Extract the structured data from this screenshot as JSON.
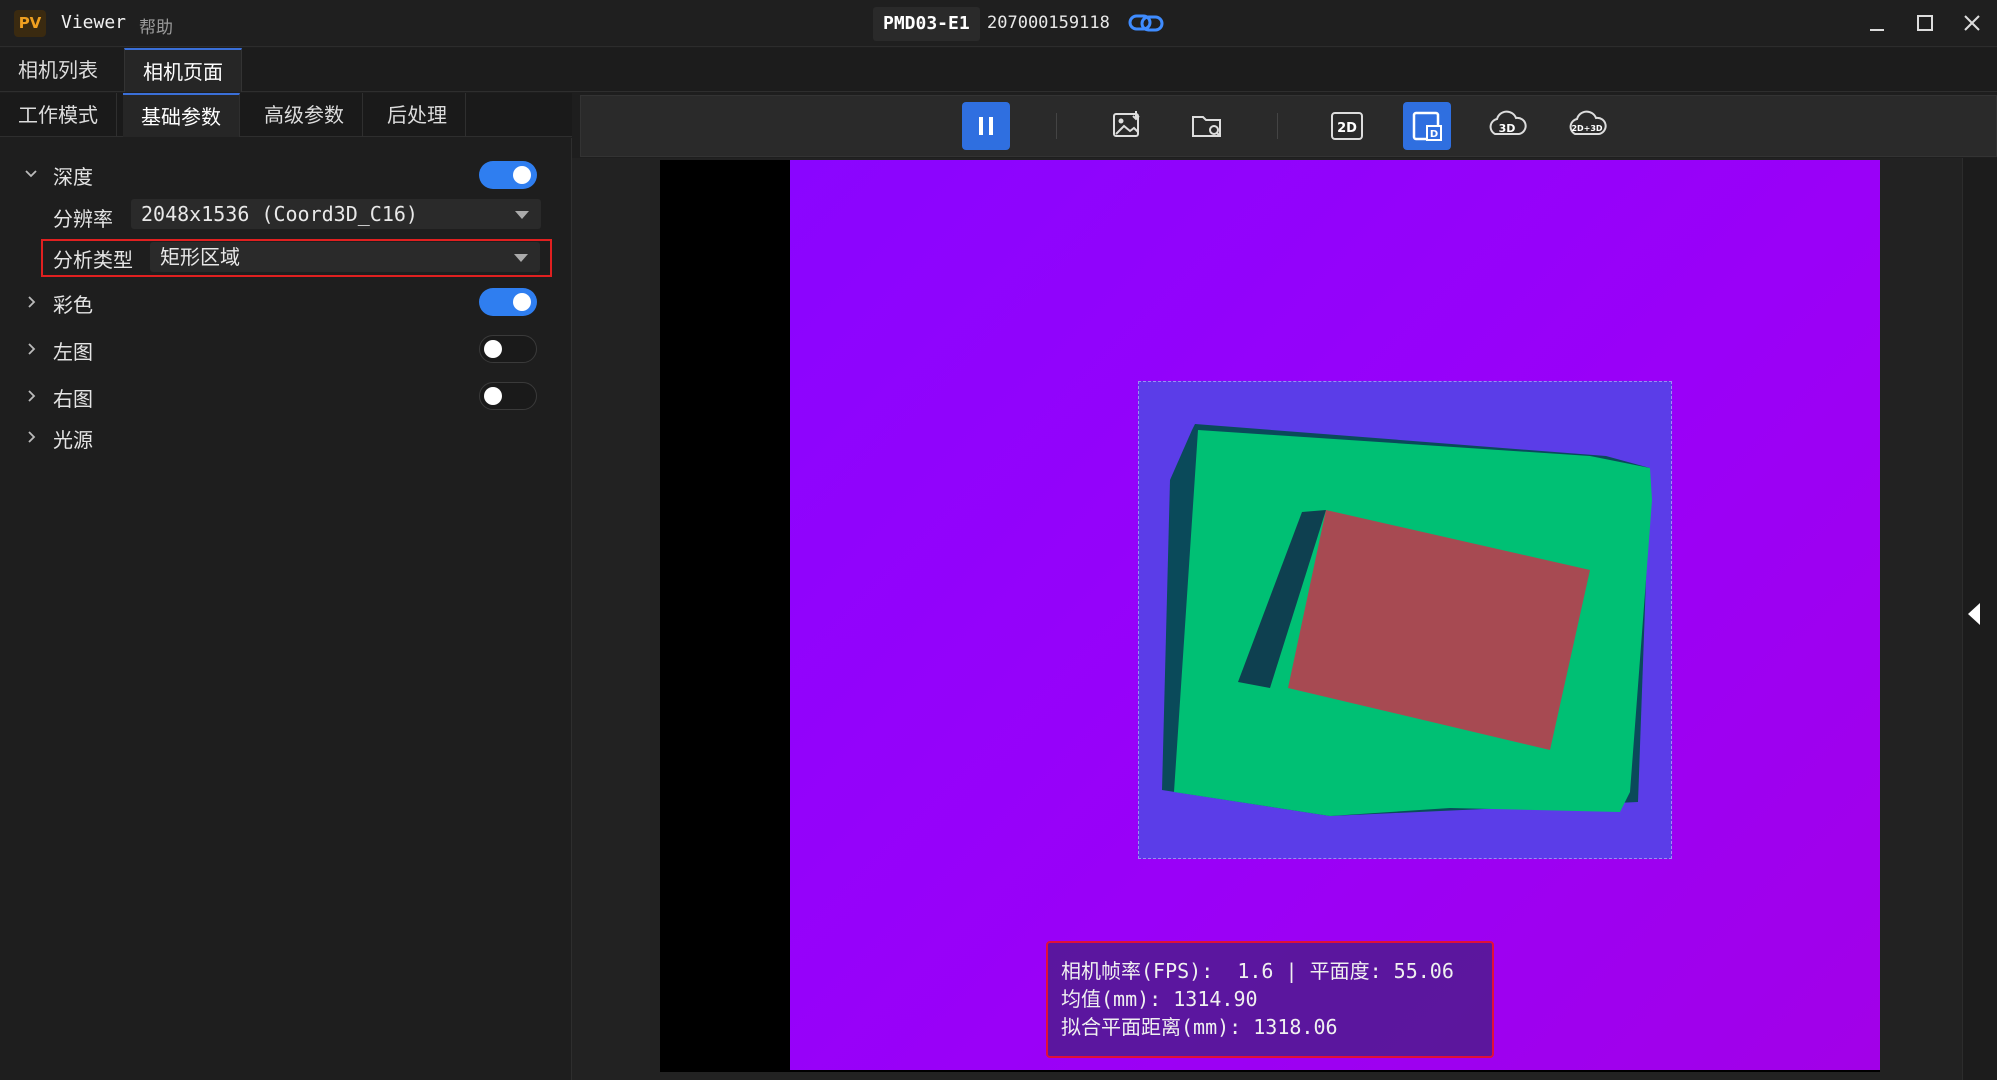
{
  "app": {
    "logo": "PV",
    "name": "Viewer",
    "menu_help": "帮助"
  },
  "camera": {
    "model": "PMD03-E1",
    "serial": "207000159118"
  },
  "tabs_top": [
    {
      "label": "相机列表",
      "active": false
    },
    {
      "label": "相机页面",
      "active": true
    }
  ],
  "tabs_sub": [
    {
      "label": "工作模式",
      "active": false
    },
    {
      "label": "基础参数",
      "active": true
    },
    {
      "label": "高级参数",
      "active": false
    },
    {
      "label": "后处理",
      "active": false
    }
  ],
  "params": {
    "depth": {
      "label": "深度",
      "enabled": true
    },
    "resolution": {
      "label": "分辨率",
      "value": "2048x1536 (Coord3D_C16)"
    },
    "analysis": {
      "label": "分析类型",
      "value": "矩形区域"
    },
    "color": {
      "label": "彩色",
      "enabled": true
    },
    "left": {
      "label": "左图",
      "enabled": false
    },
    "right": {
      "label": "右图",
      "enabled": false
    },
    "light": {
      "label": "光源"
    }
  },
  "toolbar": {
    "buttons": [
      "pause-icon",
      "save-image-icon",
      "open-folder-icon",
      "view-2d-icon",
      "view-depth-icon",
      "view-3d-icon",
      "view-2d3d-icon"
    ],
    "active": [
      "pause-icon",
      "view-depth-icon"
    ],
    "accent": "#2f6fe0"
  },
  "stats": {
    "line1": "相机帧率(FPS):  1.6 | 平面度: 55.06",
    "line2": "均值(mm): 1314.90",
    "line3": "拟合平面距离(mm): 1318.06"
  }
}
